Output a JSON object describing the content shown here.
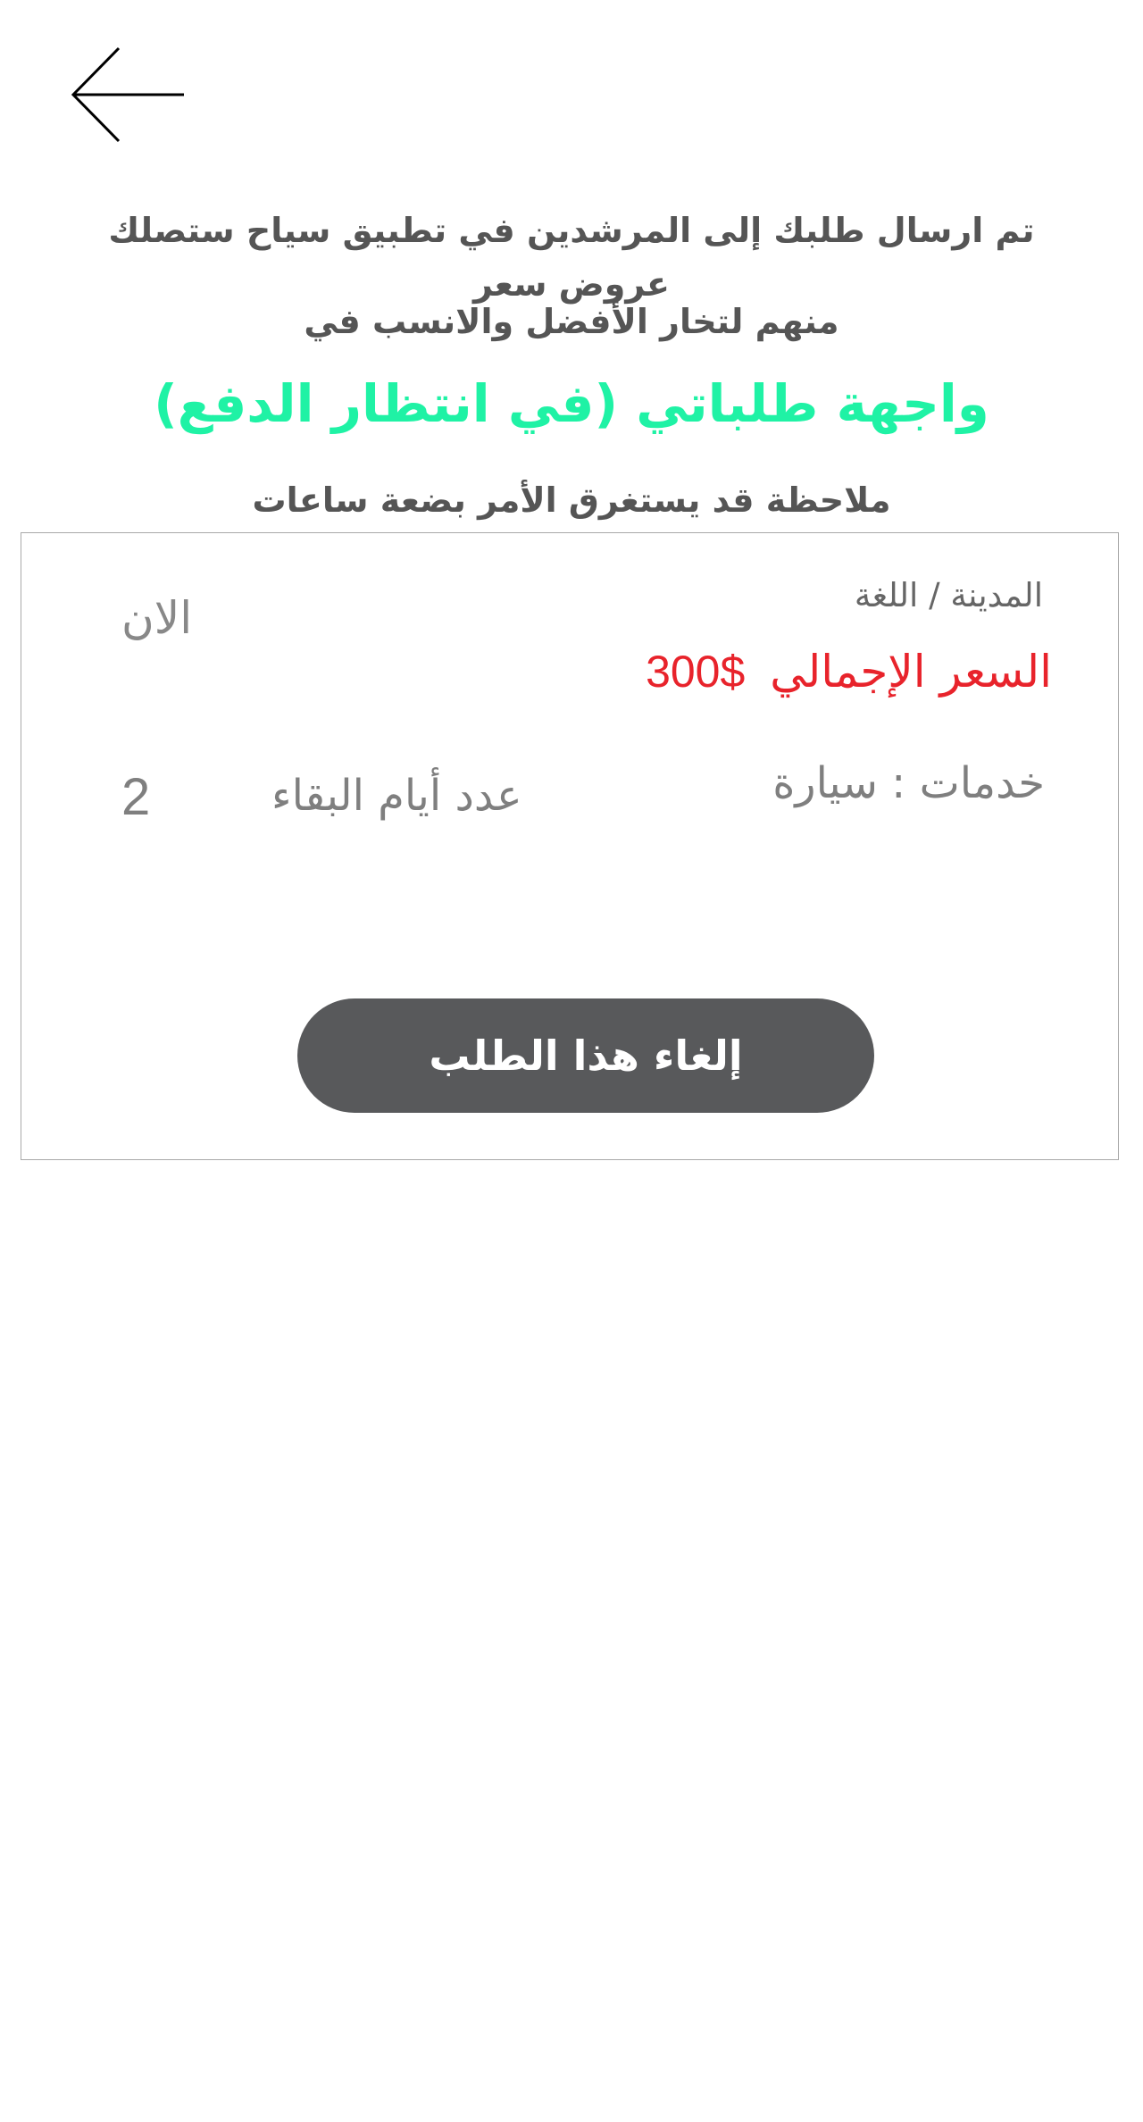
{
  "header": {
    "back_icon": "arrow-left-icon"
  },
  "message": {
    "line1": "تم ارسال طلبك إلى المرشدين في تطبيق سياح ستصلك عروض سعر",
    "line2": "منهم لتخار الأفضل والانسب في",
    "highlight": "واجهة طلباتي (في انتظار الدفع)",
    "note": "ملاحظة قد يستغرق الأمر بضعة ساعات",
    "highlight_color": "#1ff2a5"
  },
  "order": {
    "city_language": "المدينة / اللغة",
    "time": "الان",
    "total_price_label": "السعر الإجمالي",
    "total_price_value": "300$",
    "price_color": "#e8232b",
    "services": "خدمات : سيارة",
    "stay_days_label": "عدد أيام البقاء",
    "stay_days_value": "2",
    "cancel_label": "إلغاء هذا الطلب",
    "cancel_button_color": "#58595b"
  }
}
